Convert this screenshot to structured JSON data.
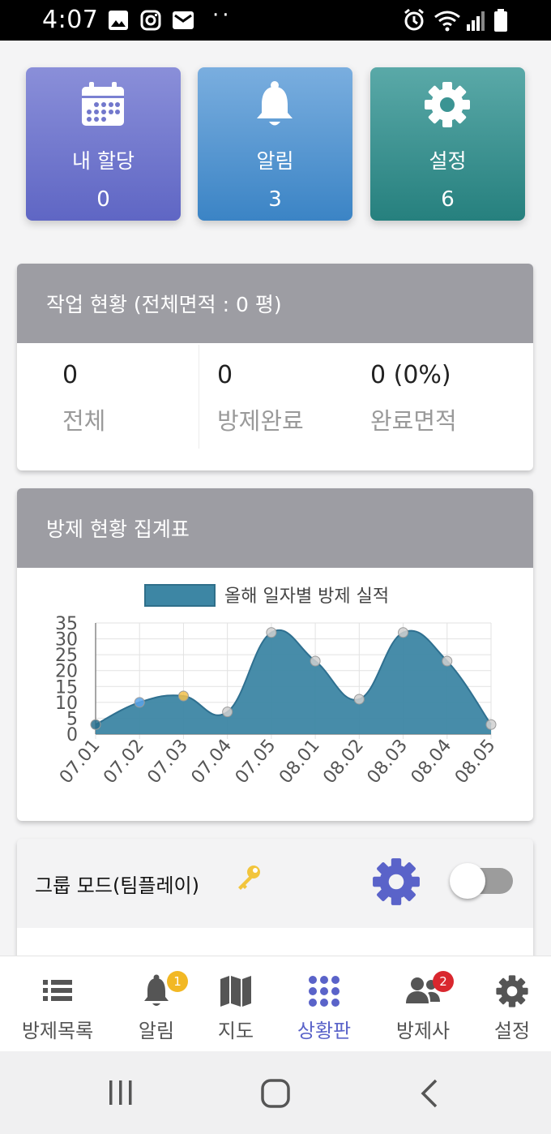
{
  "status_bar": {
    "time": "4:07",
    "dots": "··"
  },
  "tiles": [
    {
      "label": "내 할당",
      "count": "0",
      "icon": "calendar-icon",
      "color": "#6a70cc"
    },
    {
      "label": "알림",
      "count": "3",
      "icon": "bell-icon",
      "color": "#4a8ccc"
    },
    {
      "label": "설정",
      "count": "6",
      "icon": "gear-icon",
      "color": "#2f8987"
    }
  ],
  "work_status": {
    "title": "작업 현황 (전체면적 : 0 평)",
    "stats": [
      {
        "value": "0",
        "label": "전체"
      },
      {
        "value": "0",
        "label": "방제완료"
      },
      {
        "value": "0 (0%)",
        "label": "완료면적"
      }
    ]
  },
  "summary": {
    "title": "방제 현황 집계표"
  },
  "chart_data": {
    "type": "area",
    "legend": "올해 일자별 방제 실적",
    "legend_position": "top-center",
    "categories": [
      "07.01",
      "07.02",
      "07.03",
      "07.04",
      "07.05",
      "08.01",
      "08.02",
      "08.03",
      "08.04",
      "08.05"
    ],
    "values": [
      3,
      10,
      12,
      7,
      32,
      23,
      11,
      32,
      23,
      3
    ],
    "ylim": [
      0,
      35
    ],
    "yticks": [
      "35",
      "30",
      "25",
      "20",
      "15",
      "10",
      "5",
      "0"
    ],
    "grid": true,
    "fill_color": "#3d86a4",
    "point_colors": [
      "#2a6f8c",
      "#5aa3e8",
      "#f2c14e",
      "#d0d0d0",
      "#d0d0d0",
      "#d0d0d0",
      "#d0d0d0",
      "#d0d0d0",
      "#d0d0d0",
      "#d0d0d0"
    ]
  },
  "group_mode": {
    "title": "그룹 모드(팀플레이)",
    "toggle_on": false
  },
  "bottom_nav": [
    {
      "label": "방제목록",
      "icon": "list-icon",
      "active": false
    },
    {
      "label": "알림",
      "icon": "bell-icon",
      "badge": "1",
      "active": false
    },
    {
      "label": "지도",
      "icon": "map-icon",
      "active": false
    },
    {
      "label": "상황판",
      "icon": "dashboard-icon",
      "active": true
    },
    {
      "label": "방제사",
      "icon": "users-icon",
      "badge": "2",
      "active": false
    },
    {
      "label": "설정",
      "icon": "gear-icon",
      "active": false
    }
  ],
  "colors": {
    "accent": "#5a63c9",
    "badge_yellow": "#f2b824",
    "badge_red": "#d9272e"
  }
}
